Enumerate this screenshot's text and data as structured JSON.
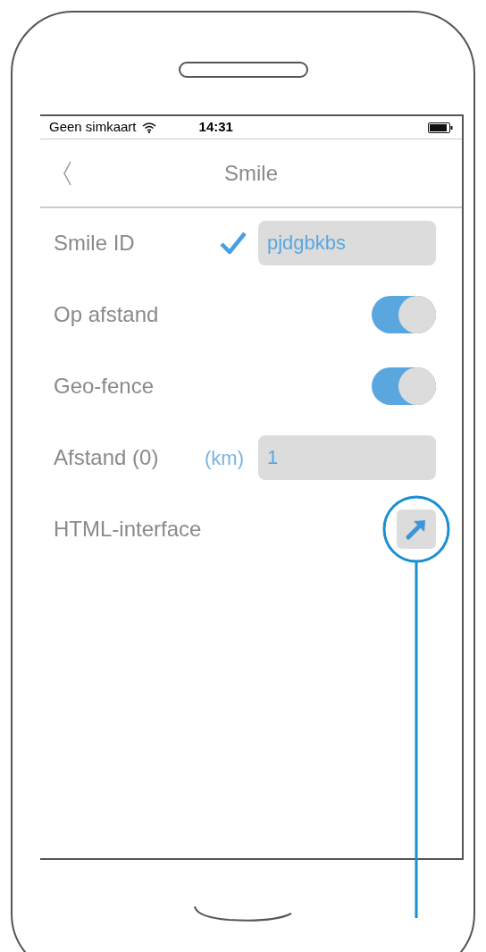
{
  "status_bar": {
    "carrier": "Geen simkaart",
    "time": "14:31"
  },
  "nav": {
    "title": "Smile"
  },
  "rows": [
    {
      "kind": "text_field",
      "label": "Smile ID",
      "verified": true,
      "value": "pjdgbkbs"
    },
    {
      "kind": "toggle",
      "label": "Op afstand",
      "on": true
    },
    {
      "kind": "toggle",
      "label": "Geo-fence",
      "on": true
    },
    {
      "kind": "unit_field",
      "label": "Afstand (0)",
      "unit": "(km)",
      "value": "1"
    },
    {
      "kind": "link",
      "label": "HTML-interface",
      "highlighted": true
    }
  ]
}
